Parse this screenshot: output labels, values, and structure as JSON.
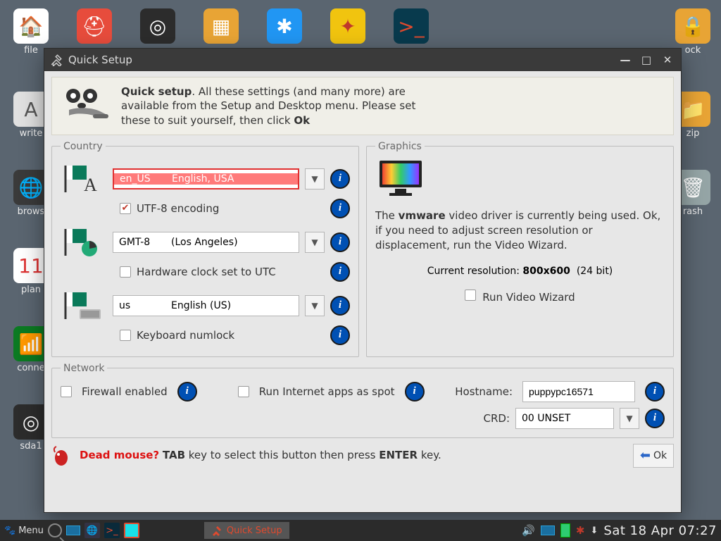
{
  "window": {
    "title": "Quick Setup"
  },
  "banner": {
    "bold": "Quick setup",
    "text": ". All these settings (and many more) are available from the Setup and Desktop menu. Please set these to suit yourself, then click ",
    "ok": "Ok"
  },
  "country": {
    "legend": "Country",
    "locale": {
      "code": "en_US",
      "label": "English, USA"
    },
    "utf8": {
      "label": "UTF-8 encoding",
      "checked": true
    },
    "tz": {
      "code": "GMT-8",
      "label": "(Los Angeles)"
    },
    "hwclock": {
      "label": "Hardware clock set to UTC",
      "checked": false
    },
    "kb": {
      "code": "us",
      "label": "English (US)"
    },
    "numlock": {
      "label": "Keyboard numlock",
      "checked": false
    }
  },
  "graphics": {
    "legend": "Graphics",
    "line1a": "The ",
    "driver": "vmware",
    "line1b": " video driver is currently being used. Ok, if you need to adjust screen resolution or displacement, run the Video Wizard.",
    "reslabel": "Current resolution: ",
    "resolution": "800x600",
    "depth": "(24 bit)",
    "runwiz": {
      "label": "Run Video Wizard",
      "checked": false
    }
  },
  "network": {
    "legend": "Network",
    "firewall": {
      "label": "Firewall enabled",
      "checked": false
    },
    "spot": {
      "label": "Run Internet apps as spot",
      "checked": false
    },
    "hostlabel": "Hostname:",
    "hostname": "puppypc16571",
    "crdlabel": "CRD:",
    "crd": "00 UNSET"
  },
  "footer": {
    "red": "Dead mouse?",
    "bold1": "TAB",
    "mid": " key to select this button then press ",
    "bold2": "ENTER",
    "tail": " key.",
    "ok": "Ok"
  },
  "desktop_top": [
    {
      "label": "file",
      "cls": "bg-w",
      "glyph": "🏠"
    },
    {
      "label": "",
      "cls": "bg-r",
      "glyph": "⛑"
    },
    {
      "label": "",
      "cls": "bg-d",
      "glyph": "◎"
    },
    {
      "label": "",
      "cls": "bg-o",
      "glyph": "▦"
    },
    {
      "label": "",
      "cls": "bg-b",
      "glyph": "✱"
    },
    {
      "label": "",
      "cls": "bg-y",
      "glyph": "✦"
    },
    {
      "label": "",
      "cls": "bg-db",
      "glyph": ">_"
    }
  ],
  "desktop_lock": {
    "label": "ock",
    "glyph": "🔒"
  },
  "desktop_left": [
    {
      "label": "write",
      "cls": "bg-lg",
      "glyph": "A"
    },
    {
      "label": "brows",
      "cls": "bg-g",
      "glyph": "🌐"
    },
    {
      "label": "plan",
      "cls": "bg-pad",
      "glyph": "11"
    },
    {
      "label": "conne",
      "cls": "bg-gr",
      "glyph": "📶"
    },
    {
      "label": "sda1",
      "cls": "bg-d",
      "glyph": "◎"
    }
  ],
  "desktop_right": [
    {
      "label": "zip",
      "cls": "bg-o",
      "glyph": "📁"
    },
    {
      "label": "rash",
      "cls": "bg-trash",
      "glyph": "🗑"
    }
  ],
  "taskbar": {
    "menu": "Menu",
    "app": "Quick Setup",
    "clock": "Sat 18 Apr 07:27"
  }
}
